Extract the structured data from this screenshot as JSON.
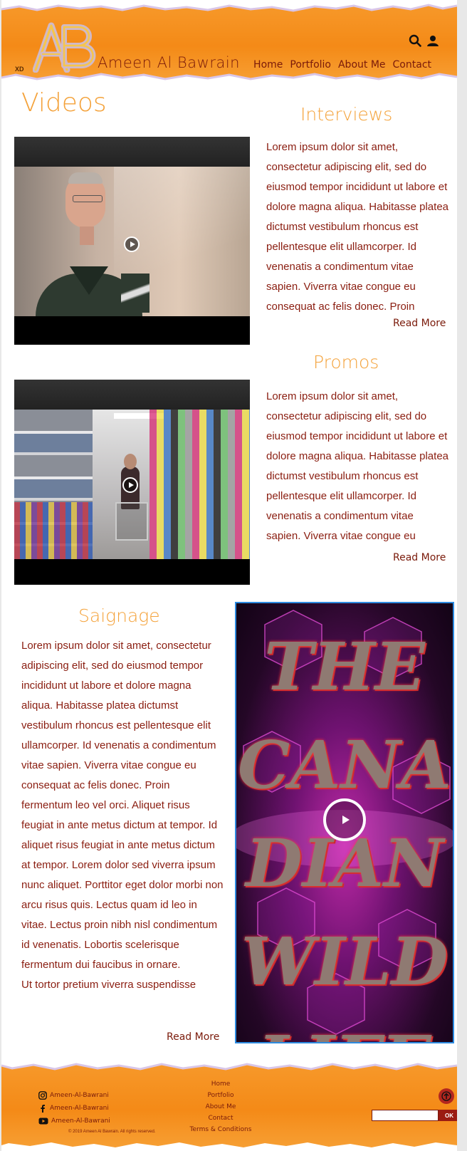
{
  "header": {
    "xd_label": "XD",
    "brand_name": "Ameen Al Bawrain",
    "nav": [
      "Home",
      "Portfolio",
      "About Me",
      "Contact"
    ],
    "icons": [
      "search-icon",
      "user-icon"
    ]
  },
  "main": {
    "page_title": "Videos",
    "sections": [
      {
        "title": "Interviews",
        "text": "Lorem ipsum dolor sit amet, consectetur adipiscing elit, sed do eiusmod tempor incididunt ut labore et dolore magna aliqua. Habitasse platea dictumst vestibulum rhoncus est pellentesque elit ullamcorper. Id venenatis a condimentum vitae sapien. Viverra vitae congue eu consequat ac felis donec. Proin",
        "read_more": "Read More"
      },
      {
        "title": "Promos",
        "text": "Lorem ipsum dolor sit amet, consectetur adipiscing elit, sed do eiusmod tempor incididunt ut labore et dolore magna aliqua. Habitasse platea dictumst vestibulum rhoncus est pellentesque elit ullamcorper. Id venenatis a condimentum vitae sapien. Viverra vitae congue eu",
        "read_more": "Read More"
      },
      {
        "title": "Saignage",
        "text": "Lorem ipsum dolor sit amet, consectetur adipiscing elit, sed do eiusmod tempor incididunt ut labore et dolore magna aliqua. Habitasse platea dictumst vestibulum rhoncus est pellentesque elit ullamcorper. Id venenatis a condimentum vitae sapien. Viverra vitae congue eu consequat ac felis donec. Proin fermentum leo vel orci. Aliquet risus feugiat in ante metus dictum at tempor. Id aliquet risus feugiat in ante metus dictum at tempor. Lorem dolor sed viverra ipsum nunc aliquet. Porttitor eget dolor morbi non arcu risus quis. Lectus quam id leo in vitae. Lectus proin nibh nisl condimentum id venenatis. Lobortis scelerisque fermentum dui faucibus in ornare.",
        "text_extra": "Ut tortor pretium viverra suspendisse",
        "read_more": "Read More",
        "poster_text": "THE CANADIAN WILD LIFE"
      }
    ]
  },
  "footer": {
    "social": [
      {
        "icon": "instagram-icon",
        "handle": "Ameen-Al-Bawrani"
      },
      {
        "icon": "facebook-icon",
        "handle": "Ameen-Al-Bawrani"
      },
      {
        "icon": "youtube-icon",
        "handle": "Ameen-Al-Bawrani"
      }
    ],
    "copyright": "© 2019 Ameen Al Bawrain. All rights reserved.",
    "nav": [
      "Home",
      "Portfolio",
      "About Me",
      "Contact",
      "Terms & Conditions"
    ],
    "search_button": "OK",
    "search_value": ""
  },
  "colors": {
    "brand_orange": "#f48a17",
    "title_orange": "#f4a23a",
    "text_red": "#8a1d10",
    "dark_red": "#7a1a0a"
  }
}
